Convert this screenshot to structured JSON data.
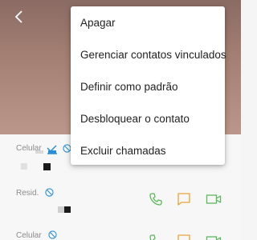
{
  "menu": {
    "items": [
      {
        "label": "Apagar"
      },
      {
        "label": "Gerenciar contatos vinculados"
      },
      {
        "label": "Definir como padrão"
      },
      {
        "label": "Desbloquear o contato"
      },
      {
        "label": "Excluir chamadas"
      }
    ]
  },
  "numbers": [
    {
      "label": "Celular"
    },
    {
      "label": "Resid."
    },
    {
      "label": "Celular"
    }
  ],
  "colors": {
    "accent_blue": "#2b8fd6",
    "call_green": "#5cb85c",
    "message_orange": "#e8a23a",
    "video_green": "#5cb85c"
  },
  "icons": {
    "back": "chevron-left-icon",
    "block": "block-icon",
    "default": "default-check-icon",
    "call": "phone-icon",
    "message": "message-icon",
    "video": "video-icon"
  }
}
